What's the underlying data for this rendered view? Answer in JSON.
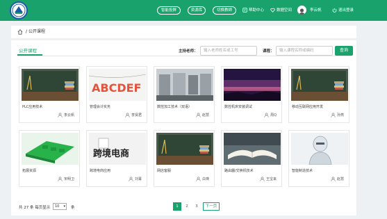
{
  "header": {
    "nav_pills": [
      "智能投屏",
      "资源库",
      "切换教師"
    ],
    "nav_links": {
      "help": "帮助中心",
      "data_space": "数据空间",
      "user": "李云帆",
      "logout": "退出登录"
    }
  },
  "breadcrumb": {
    "separator": "/",
    "current": "公开课程"
  },
  "filters": {
    "title": "公开课程",
    "host_label": "主持老师：",
    "host_placeholder": "输入老师姓名或工号",
    "course_label": "课程：",
    "course_placeholder": "输入课程名称或编码",
    "query_button": "查询"
  },
  "courses": [
    {
      "title": "PLC应用技术",
      "teacher": "李云帆",
      "thumb": "chalkboard-books"
    },
    {
      "title": "管理会计实务",
      "teacher": "李贤君",
      "thumb": "colorful-letters"
    },
    {
      "title": "数控加工技术（双语）",
      "teacher": "赵慧",
      "thumb": "cnc-machines"
    },
    {
      "title": "数控机床安装调试",
      "teacher": "周Q",
      "thumb": "night-sky"
    },
    {
      "title": "移动互联网应用开发",
      "teacher": "孙燕",
      "thumb": "chalkboard-books"
    },
    {
      "title": "拓展资源",
      "teacher": "宋明卫",
      "thumb": "green-keyboard"
    },
    {
      "title": "跨境电商应用",
      "teacher": "刘菁",
      "thumb": "cross-border-ecommerce"
    },
    {
      "title": "网店客服",
      "teacher": "白瑛",
      "thumb": "chalkboard-books"
    },
    {
      "title": "路由器/交换机技术",
      "teacher": "王宝来",
      "thumb": "open-book"
    },
    {
      "title": "智能制造技术",
      "teacher": "赵慧",
      "thumb": "robot"
    }
  ],
  "thumb_texts": {
    "letters": "ABCDEF",
    "ecommerce": "跨境电商"
  },
  "pagination": {
    "total_prefix": "共 27 条  每页显示",
    "page_size": "10",
    "suffix": "条",
    "pages": [
      "1",
      "2",
      "3"
    ],
    "current_page": "1",
    "next_label": "下一页"
  },
  "colors": {
    "brand": "#1aa26d",
    "logo_border": "#1d5aa8"
  }
}
